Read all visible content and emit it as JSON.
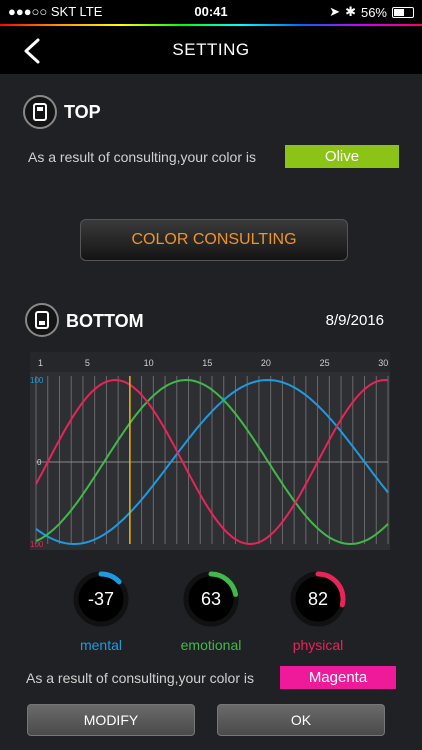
{
  "status": {
    "carrier": "●●●○○ SKT  LTE",
    "time": "00:41",
    "battery": "56%",
    "battery_level": 0.56
  },
  "nav": {
    "title": "SETTING",
    "back_icon": "chevron-left-icon"
  },
  "top": {
    "title": "TOP",
    "result_text": "As a result of consulting,your color is",
    "color_name": "Olive",
    "color_hex": "#8bc416"
  },
  "consult_button": "COLOR CONSULTING",
  "bottom": {
    "title": "BOTTOM",
    "date": "8/9/2016",
    "result_text": "As a result of consulting,your color is",
    "color_name": "Magenta",
    "color_hex": "#ee1a9a"
  },
  "chart_data": {
    "type": "line",
    "x_ticks": [
      "1",
      "5",
      "10",
      "15",
      "20",
      "25",
      "30"
    ],
    "x_range": [
      1,
      31
    ],
    "y_labels": {
      "top": "100",
      "mid": "0",
      "bottom": "100"
    },
    "y_range": [
      -100,
      100
    ],
    "current_day": 9,
    "series": [
      {
        "period": 33,
        "phase_day": 12.5,
        "color": "#1e9be0"
      },
      {
        "period": 28,
        "phase_day": 6.8,
        "color": "#41b84a"
      },
      {
        "period": 23,
        "phase_day": 2,
        "color": "#e8245a"
      }
    ]
  },
  "gauges": [
    {
      "value": "-37",
      "level": 0.37,
      "label": "mental",
      "color": "#1e9be0"
    },
    {
      "value": "63",
      "level": 0.63,
      "label": "emotional",
      "color": "#41b84a"
    },
    {
      "value": "82",
      "level": 0.82,
      "label": "physical",
      "color": "#e8245a"
    }
  ],
  "buttons": {
    "modify": "MODIFY",
    "ok": "OK"
  }
}
